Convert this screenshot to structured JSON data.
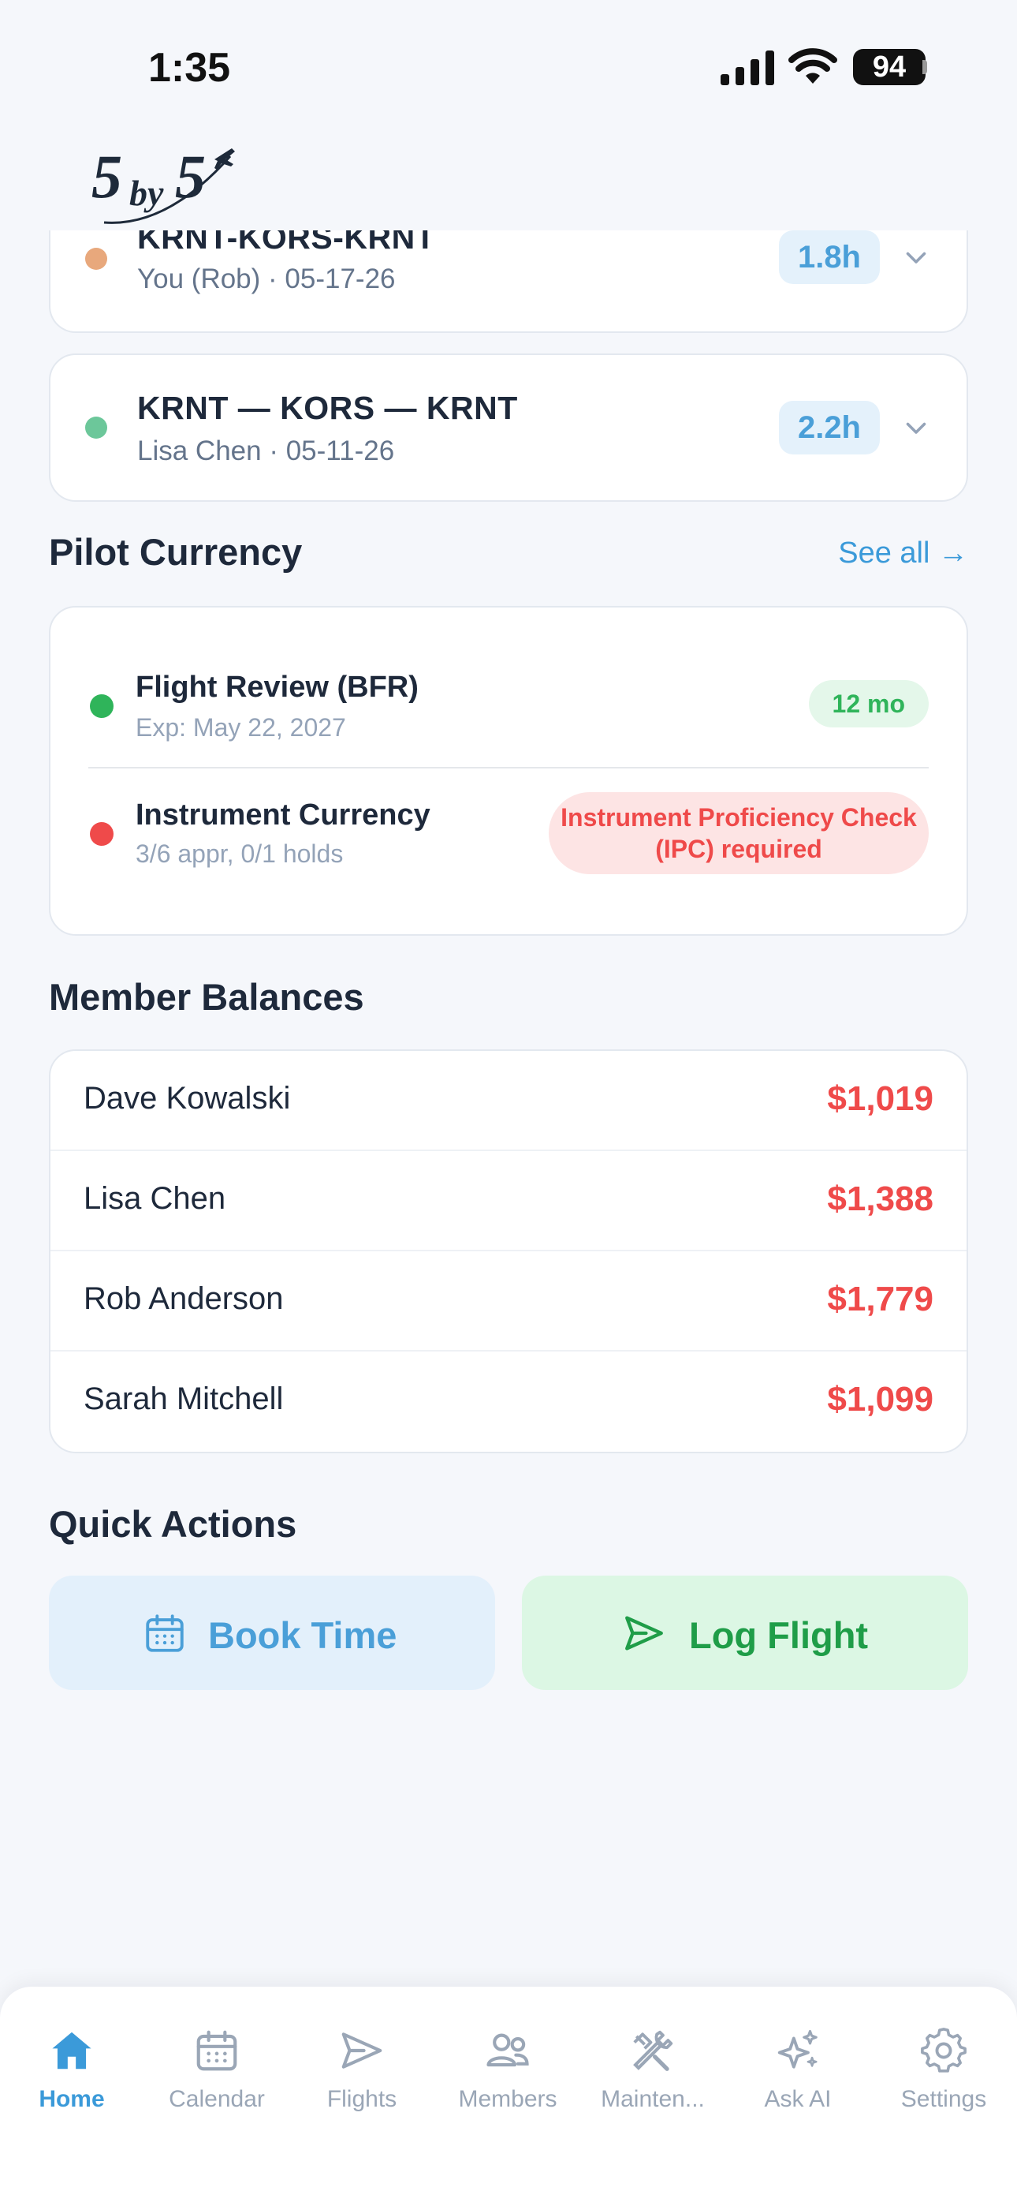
{
  "status_bar": {
    "time": "1:35",
    "battery": "94"
  },
  "logo": {
    "text": "5by5"
  },
  "recent_flights": [
    {
      "route": "KRNT-KORS-KRNT",
      "pilot_date": "You (Rob) · 05-17-26",
      "hours": "1.8h",
      "dot_color": "#e8a87c"
    },
    {
      "route": "KRNT — KORS — KRNT",
      "pilot_date": "Lisa Chen · 05-11-26",
      "hours": "2.2h",
      "dot_color": "#6cc79a"
    }
  ],
  "pilot_currency": {
    "title": "Pilot Currency",
    "see_all": "See all →",
    "items": [
      {
        "name": "Flight Review (BFR)",
        "detail": "Exp: May 22, 2027",
        "status": "12 mo",
        "dot_color": "#2fb45a"
      },
      {
        "name": "Instrument Currency",
        "detail": "3/6 appr, 0/1 holds",
        "status": "Instrument Proficiency Check (IPC) required",
        "dot_color": "#ef4a4a"
      }
    ]
  },
  "member_balances": {
    "title": "Member Balances",
    "rows": [
      {
        "name": "Dave Kowalski",
        "amount": "$1,019"
      },
      {
        "name": "Lisa Chen",
        "amount": "$1,388"
      },
      {
        "name": "Rob Anderson",
        "amount": "$1,779"
      },
      {
        "name": "Sarah Mitchell",
        "amount": "$1,099"
      }
    ]
  },
  "quick_actions": {
    "title": "Quick Actions",
    "book_time": "Book Time",
    "log_flight": "Log Flight"
  },
  "tabs": [
    {
      "label": "Home",
      "icon": "home-icon",
      "active": true
    },
    {
      "label": "Calendar",
      "icon": "calendar-icon",
      "active": false
    },
    {
      "label": "Flights",
      "icon": "send-icon",
      "active": false
    },
    {
      "label": "Members",
      "icon": "members-icon",
      "active": false
    },
    {
      "label": "Mainten...",
      "icon": "wrench-icon",
      "active": false
    },
    {
      "label": "Ask AI",
      "icon": "sparkles-icon",
      "active": false
    },
    {
      "label": "Settings",
      "icon": "gear-icon",
      "active": false
    }
  ],
  "colors": {
    "accent": "#3b9ad9",
    "danger": "#ef4a4a",
    "success": "#2fb45a"
  }
}
